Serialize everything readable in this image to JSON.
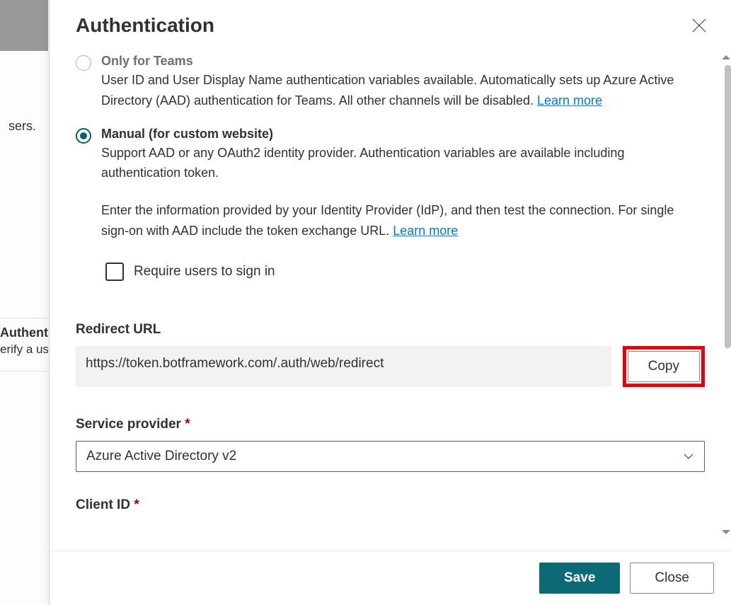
{
  "background": {
    "sers_fragment": "sers.",
    "auth_title": "Authentication",
    "auth_sub": "erify a user's identity."
  },
  "panel": {
    "title": "Authentication"
  },
  "options": {
    "teams": {
      "title": "Only for Teams",
      "desc": "User ID and User Display Name authentication variables available. Automatically sets up Azure Active Directory (AAD) authentication for Teams. All other channels will be disabled. ",
      "learn_more": "Learn more"
    },
    "manual": {
      "title": "Manual (for custom website)",
      "desc": "Support AAD or any OAuth2 identity provider. Authentication variables are available including authentication token.",
      "instructions": "Enter the information provided by your Identity Provider (IdP), and then test the connection. For single sign-on with AAD include the token exchange URL. ",
      "learn_more": "Learn more"
    }
  },
  "checkbox": {
    "label": "Require users to sign in"
  },
  "fields": {
    "redirect": {
      "label": "Redirect URL",
      "value": "https://token.botframework.com/.auth/web/redirect",
      "copy": "Copy"
    },
    "service_provider": {
      "label": "Service provider",
      "value": "Azure Active Directory v2"
    },
    "client_id": {
      "label": "Client ID"
    }
  },
  "footer": {
    "save": "Save",
    "close": "Close"
  }
}
